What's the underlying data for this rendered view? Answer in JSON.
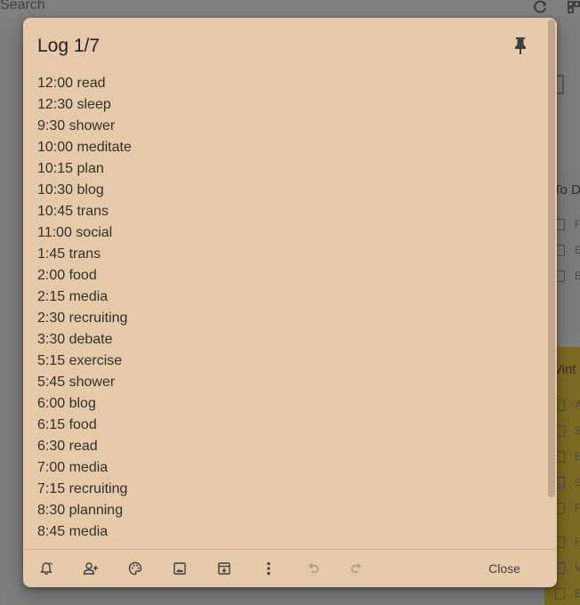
{
  "background": {
    "search_placeholder": "Search",
    "refresh_icon": "refresh-icon",
    "grid_icon": "grid-view-icon",
    "card_gray_title": "To D",
    "card_gray_items": [
      "F",
      "E",
      "E"
    ],
    "card_yellow_title": "Vint",
    "card_yellow_items": [
      "A",
      "S",
      "E",
      "S",
      "F",
      "F",
      "V",
      "E"
    ]
  },
  "note": {
    "title": "Log 1/7",
    "pinned": true,
    "lines": [
      "12:00 read",
      "12:30 sleep",
      "9:30 shower",
      "10:00 meditate",
      "10:15 plan",
      "10:30 blog",
      "10:45 trans",
      "11:00 social",
      "1:45 trans",
      "2:00 food",
      "2:15 media",
      "2:30 recruiting",
      "3:30 debate",
      "5:15 exercise",
      "5:45 shower",
      "6:00 blog",
      "6:15 food",
      "6:30 read",
      "7:00 media",
      "7:15 recruiting",
      "8:30 planning",
      "8:45 media"
    ],
    "toolbar": {
      "icons": [
        "remind-me-icon",
        "collaborator-icon",
        "palette-icon",
        "image-icon",
        "archive-icon",
        "more-icon",
        "undo-icon",
        "redo-icon"
      ],
      "close_label": "Close"
    }
  },
  "colors": {
    "note_bg": "#e6c9a8",
    "overlay": "#7d7d7d",
    "text": "#303030"
  }
}
